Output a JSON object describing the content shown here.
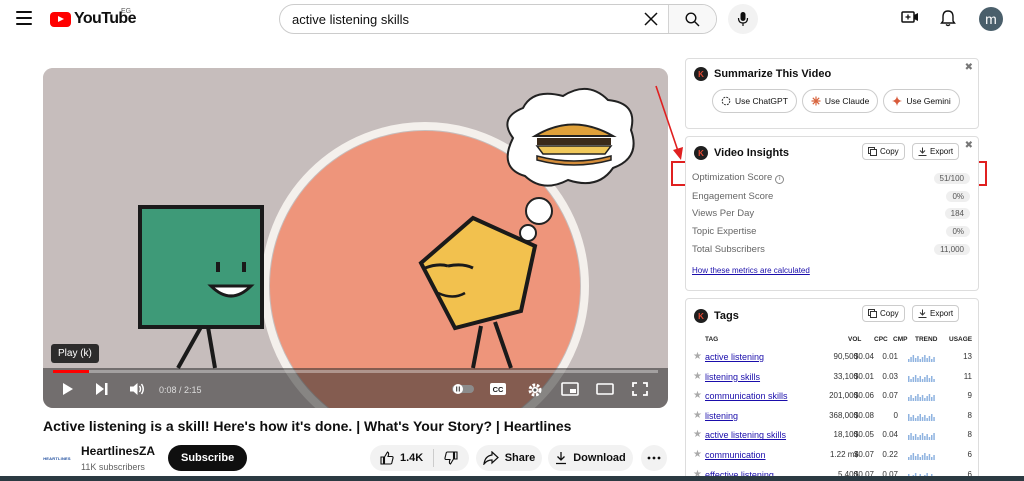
{
  "header": {
    "logo_text": "YouTube",
    "country": "EG",
    "search_value": "active listening skills",
    "avatar_letter": "m"
  },
  "player": {
    "tooltip": "Play (k)",
    "timecode": "0:08 / 2:15",
    "progress_fraction": 0.06,
    "cc_label": "CC"
  },
  "video": {
    "title": "Active listening is a skill! Here's how it's done. | What's Your Story? | Heartlines",
    "channel_name": "HeartlinesZA",
    "channel_logo_text": "HEARTLINES",
    "subscribers": "11K subscribers",
    "subscribe_label": "Subscribe",
    "likes": "1.4K",
    "share_label": "Share",
    "download_label": "Download"
  },
  "summarize_panel": {
    "logo": "K",
    "title": "Summarize This Video",
    "buttons": [
      "Use ChatGPT",
      "Use Claude",
      "Use Gemini"
    ]
  },
  "insights_panel": {
    "title": "Video Insights",
    "copy_label": "Copy",
    "export_label": "Export",
    "metrics": [
      {
        "label": "Optimization Score",
        "value": "51/100"
      },
      {
        "label": "Engagement Score",
        "value": "0%"
      },
      {
        "label": "Views Per Day",
        "value": "184"
      },
      {
        "label": "Topic Expertise",
        "value": "0%"
      },
      {
        "label": "Total Subscribers",
        "value": "11,000"
      }
    ],
    "info_icon": "i",
    "link": "How these metrics are calculated"
  },
  "tags_panel": {
    "title": "Tags",
    "copy_label": "Copy",
    "export_label": "Export",
    "headers": {
      "tag": "TAG",
      "vol": "VOL",
      "cpc": "CPC",
      "cmp": "CMP",
      "trend": "TREND",
      "usage": "USAGE"
    },
    "rows": [
      {
        "tag": "active listening",
        "vol": "90,500",
        "cpc": "$0.04",
        "cmp": "0.01",
        "usage": "13"
      },
      {
        "tag": "listening skills",
        "vol": "33,100",
        "cpc": "$0.01",
        "cmp": "0.03",
        "usage": "11"
      },
      {
        "tag": "communication skills",
        "vol": "201,000",
        "cpc": "$0.06",
        "cmp": "0.07",
        "usage": "9"
      },
      {
        "tag": "listening",
        "vol": "368,000",
        "cpc": "$0.08",
        "cmp": "0",
        "usage": "8"
      },
      {
        "tag": "active listening skills",
        "vol": "18,100",
        "cpc": "$0.05",
        "cmp": "0.04",
        "usage": "8"
      },
      {
        "tag": "communication",
        "vol": "1.22 mil",
        "cpc": "$0.07",
        "cmp": "0.22",
        "usage": "6"
      },
      {
        "tag": "effective listening",
        "vol": "5,400",
        "cpc": "$0.07",
        "cmp": "0.07",
        "usage": "6"
      }
    ]
  },
  "colors": {
    "brand_red": "#ff0000",
    "annotation_red": "#e02020",
    "link_blue": "#1a0dab"
  }
}
